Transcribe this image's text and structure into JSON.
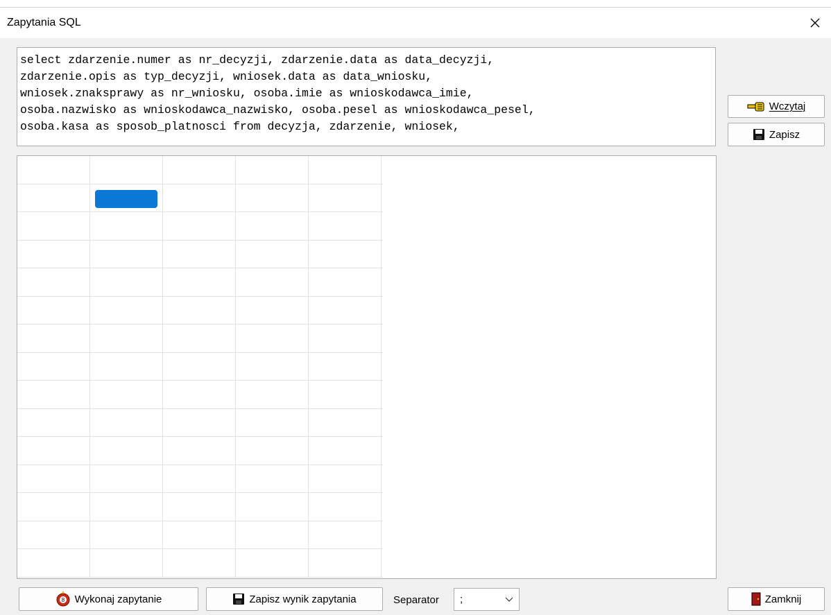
{
  "window": {
    "title": "Zapytania SQL"
  },
  "query": {
    "text": "select zdarzenie.numer as nr_decyzji, zdarzenie.data as data_decyzji,\nzdarzenie.opis as typ_decyzji, wniosek.data as data_wniosku,\nwniosek.znaksprawy as nr_wniosku, osoba.imie as wnioskodawca_imie,\nosoba.nazwisko as wnioskodawca_nazwisko, osoba.pesel as wnioskodawca_pesel,\nosoba.kasa as sposob_platnosci from decyzja, zdarzenie, wniosek,"
  },
  "side_buttons": {
    "load": "Wczytaj",
    "save": "Zapisz"
  },
  "bottom": {
    "execute": "Wykonaj zapytanie",
    "save_result": "Zapisz wynik zapytania",
    "separator_label": "Separator",
    "separator_value": ";",
    "close": "Zamknij"
  },
  "grid": {
    "columns": 5,
    "rows": 15,
    "selected_cell": {
      "row": 1,
      "col": 1
    }
  },
  "colors": {
    "selection": "#0b78d6",
    "background": "#f0f0f0"
  }
}
